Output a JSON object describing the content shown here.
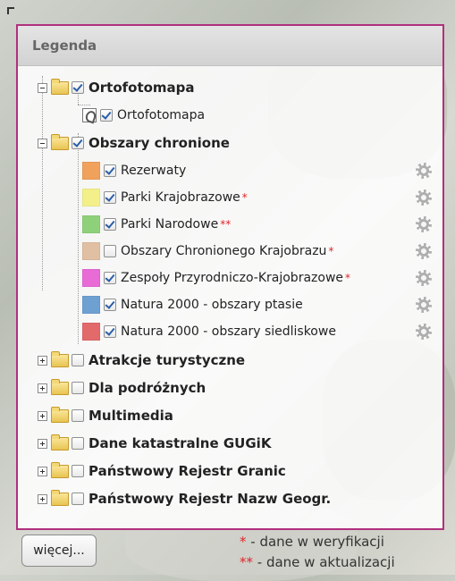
{
  "legend": {
    "title": "Legenda",
    "groups": [
      {
        "label": "Ortofotomapa",
        "checked": true,
        "expanded": true,
        "items": [
          {
            "label": "Ortofotomapa",
            "checked": true,
            "icon": "raster-icon"
          }
        ]
      },
      {
        "label": "Obszary chronione",
        "checked": true,
        "expanded": true,
        "items": [
          {
            "label": "Rezerwaty",
            "checked": true,
            "color": "#f0a15c",
            "marker": ""
          },
          {
            "label": "Parki Krajobrazowe",
            "checked": true,
            "color": "#f3f08a",
            "marker": "*"
          },
          {
            "label": "Parki Narodowe",
            "checked": true,
            "color": "#8fd17a",
            "marker": "**"
          },
          {
            "label": "Obszary Chronionego Krajobrazu",
            "checked": false,
            "color": "#e0bfa3",
            "marker": "*"
          },
          {
            "label": "Zespoły Przyrodniczo-Krajobrazowe",
            "checked": true,
            "color": "#e86bd6",
            "marker": "*"
          },
          {
            "label": "Natura 2000 - obszary ptasie",
            "checked": true,
            "color": "#6fa0d2",
            "marker": ""
          },
          {
            "label": "Natura 2000 - obszary siedliskowe",
            "checked": true,
            "color": "#e36a6a",
            "marker": ""
          }
        ]
      },
      {
        "label": "Atrakcje turystyczne",
        "checked": false,
        "expanded": false
      },
      {
        "label": "Dla podróżnych",
        "checked": false,
        "expanded": false
      },
      {
        "label": "Multimedia",
        "checked": false,
        "expanded": false
      },
      {
        "label": "Dane katastralne GUGiK",
        "checked": false,
        "expanded": false
      },
      {
        "label": "Państwowy Rejestr Granic",
        "checked": false,
        "expanded": false
      },
      {
        "label": "Państwowy Rejestr Nazw Geogr.",
        "checked": false,
        "expanded": false
      }
    ]
  },
  "footer": {
    "more_button": "więcej...",
    "note_single_mark": "*",
    "note_single_text": " - dane w weryfikacji",
    "note_double_mark": "**",
    "note_double_text": " - dane w aktualizacji"
  },
  "colors": {
    "panel_border": "#b0307e",
    "star_red": "#e0252a"
  }
}
